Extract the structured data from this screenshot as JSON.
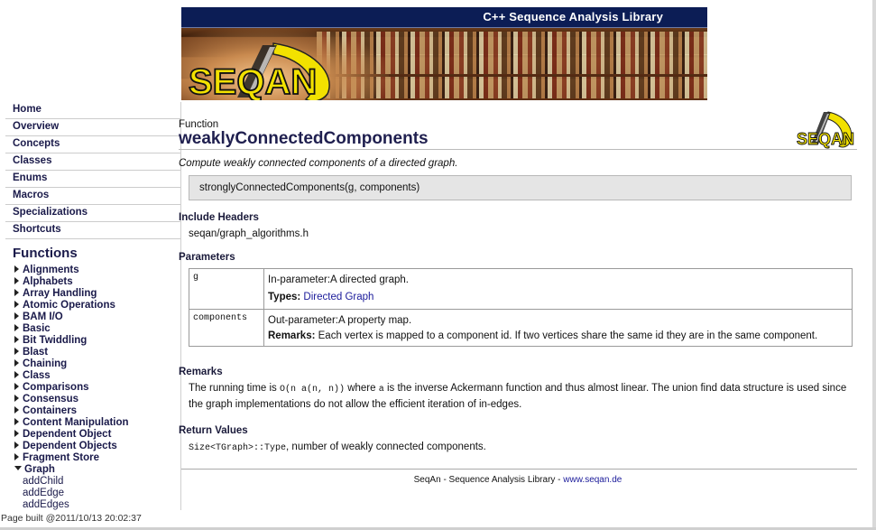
{
  "banner": {
    "title": "C++ Sequence Analysis Library",
    "logo_text": "SEQAN"
  },
  "nav": {
    "items": [
      "Home",
      "Overview",
      "Concepts",
      "Classes",
      "Enums",
      "Macros",
      "Specializations",
      "Shortcuts"
    ]
  },
  "sidebar": {
    "functions_heading": "Functions",
    "categories": [
      "Alignments",
      "Alphabets",
      "Array Handling",
      "Atomic Operations",
      "BAM I/O",
      "Basic",
      "Bit Twiddling",
      "Blast",
      "Chaining",
      "Class",
      "Comparisons",
      "Consensus",
      "Containers",
      "Content Manipulation",
      "Dependent Object",
      "Dependent Objects",
      "Fragment Store"
    ],
    "expanded_category": "Graph",
    "graph_items": [
      "addChild",
      "addEdge",
      "addEdges"
    ]
  },
  "page_built": "Page built @2011/10/13 20:02:37",
  "main": {
    "kind": "Function",
    "name": "weaklyConnectedComponents",
    "summary": "Compute weakly connected components of a directed graph.",
    "signature": "stronglyConnectedComponents(g, components)",
    "include_heading": "Include Headers",
    "include_file": "seqan/graph_algorithms.h",
    "params_heading": "Parameters",
    "params": [
      {
        "name": "g",
        "desc": "In-parameter:A directed graph.",
        "extra_label": "Types:",
        "extra_text": "Directed Graph"
      },
      {
        "name": "components",
        "desc": "Out-parameter:A property map.",
        "extra_label": "Remarks:",
        "extra_text": "Each vertex is mapped to a component id. If two vertices share the same id they are in the same component."
      }
    ],
    "remarks_heading": "Remarks",
    "remarks": {
      "pre": "The running time is ",
      "code1": "O(n a(n, n))",
      "mid": " where ",
      "code2": "a",
      "post": " is the inverse Ackermann function and thus almost linear. The union find data structure is used since the graph implementations do not allow the efficient iteration of in-edges."
    },
    "return_heading": "Return Values",
    "return_code": "Size<TGraph>::Type",
    "return_text": ", number of weakly connected components."
  },
  "footer": {
    "text": "SeqAn - Sequence Analysis Library - ",
    "link": "www.seqan.de"
  },
  "colors": {
    "banner_bar": "#0c1d55",
    "nav_text": "#1a1a4a",
    "link": "#1a1a9a",
    "signature_bg": "#e5e5e5",
    "logo_yellow": "#f2e100"
  }
}
